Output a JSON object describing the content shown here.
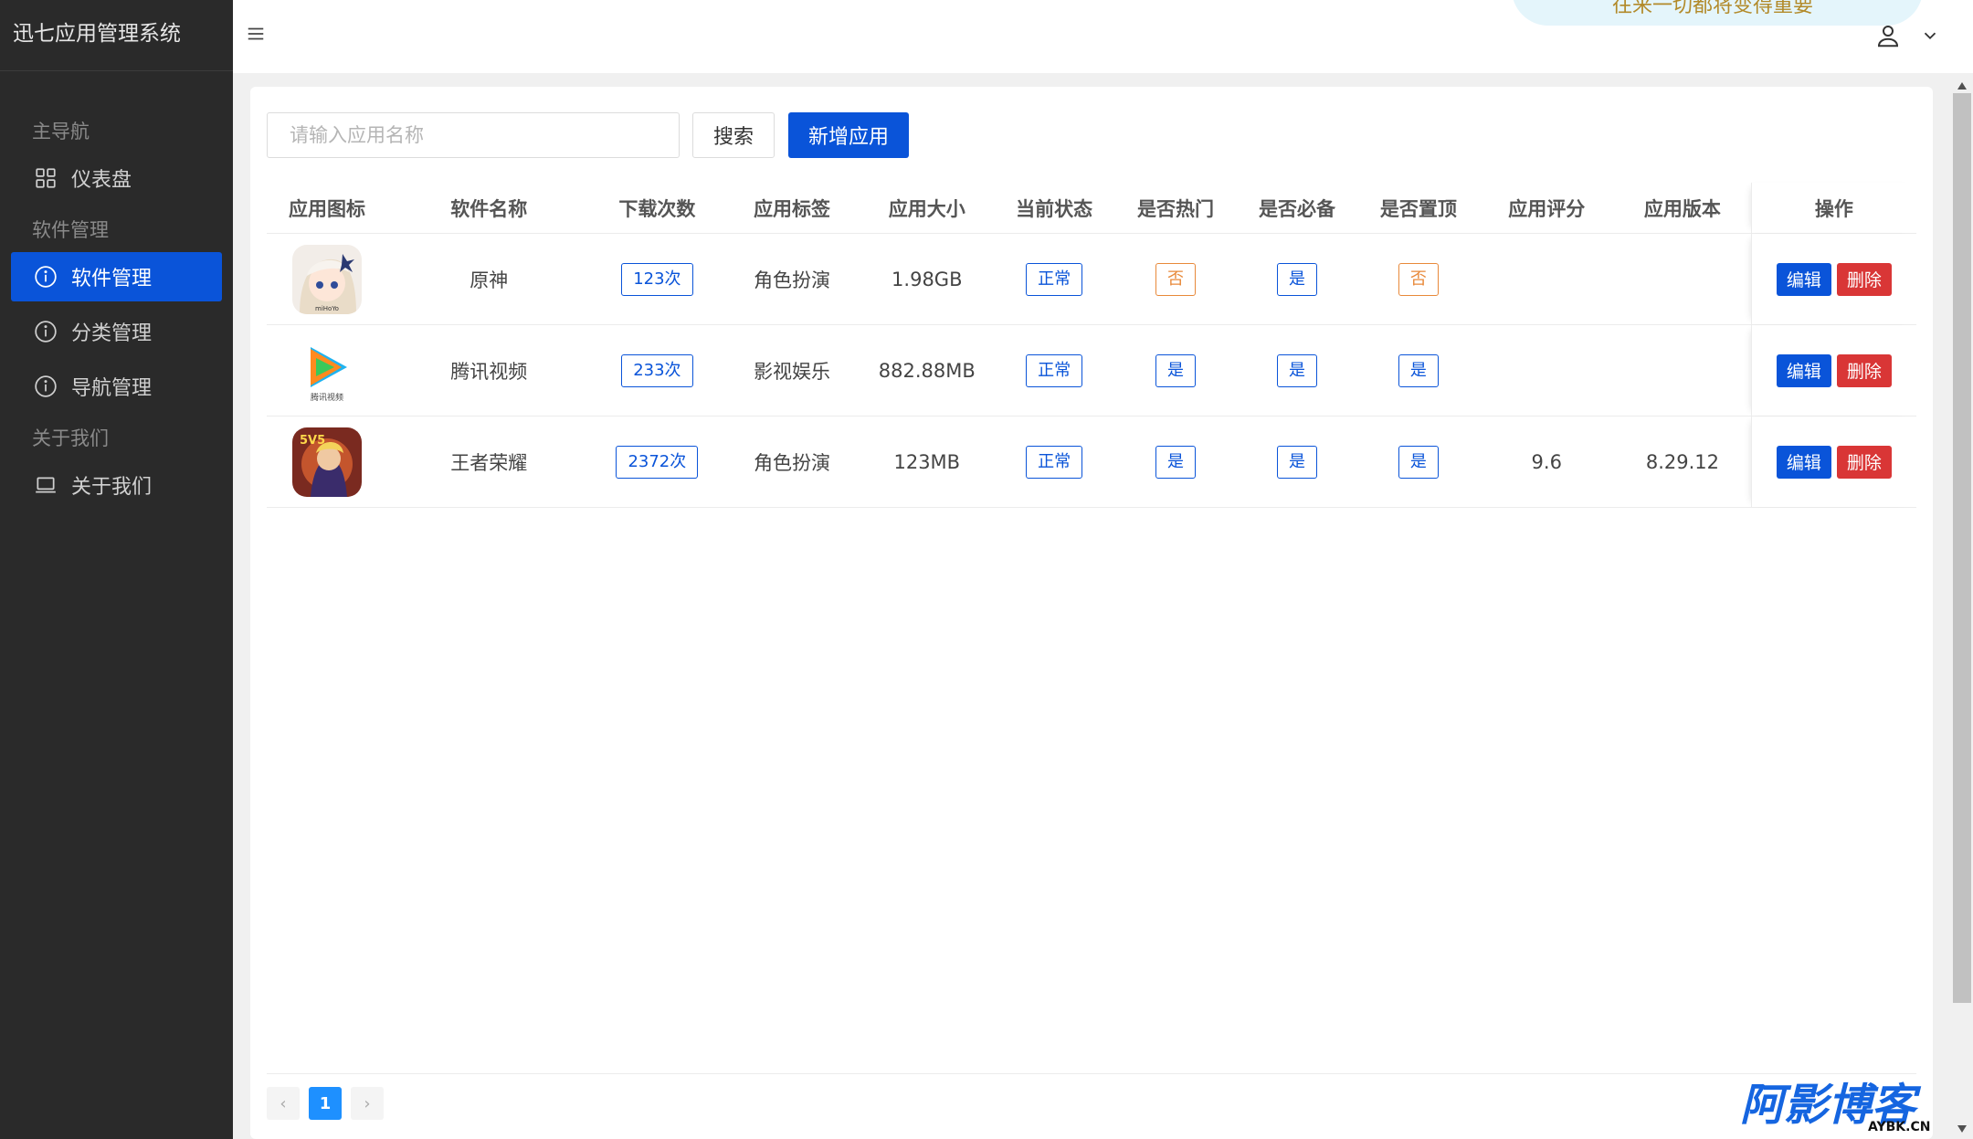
{
  "app": {
    "title": "迅七应用管理系统"
  },
  "sidebar": {
    "groups": [
      {
        "label": "主导航"
      },
      {
        "label": "软件管理"
      },
      {
        "label": "关于我们"
      }
    ],
    "items": [
      {
        "label": "仪表盘",
        "icon": "grid-icon"
      },
      {
        "label": "软件管理",
        "icon": "info-circle-icon",
        "active": true
      },
      {
        "label": "分类管理",
        "icon": "info-circle-icon"
      },
      {
        "label": "导航管理",
        "icon": "info-circle-icon"
      },
      {
        "label": "关于我们",
        "icon": "laptop-icon"
      }
    ]
  },
  "header": {
    "banner_text": "往来一切都将变得重要"
  },
  "toolbar": {
    "search_placeholder": "请输入应用名称",
    "search_label": "搜索",
    "add_label": "新增应用"
  },
  "table": {
    "columns": [
      "应用图标",
      "软件名称",
      "下载次数",
      "应用标签",
      "应用大小",
      "当前状态",
      "是否热门",
      "是否必备",
      "是否置顶",
      "应用评分",
      "应用版本",
      "操作"
    ],
    "rows": [
      {
        "name": "原神",
        "downloads": "123次",
        "tag": "角色扮演",
        "size": "1.98GB",
        "state": "正常",
        "hot": "否",
        "must": "是",
        "top": "否",
        "rating": "",
        "version": ""
      },
      {
        "name": "腾讯视频",
        "downloads": "233次",
        "tag": "影视娱乐",
        "size": "882.88MB",
        "state": "正常",
        "hot": "是",
        "must": "是",
        "top": "是",
        "rating": "",
        "version": ""
      },
      {
        "name": "王者荣耀",
        "downloads": "2372次",
        "tag": "角色扮演",
        "size": "123MB",
        "state": "正常",
        "hot": "是",
        "must": "是",
        "top": "是",
        "rating": "9.6",
        "version": "8.29.12"
      }
    ],
    "edit_label": "编辑",
    "delete_label": "删除"
  },
  "pagination": {
    "current": "1",
    "prev": "‹",
    "next": "›"
  },
  "icon_text": {
    "genshin": "miHoYo",
    "tencent": "腾讯视频",
    "honor": "5V5"
  },
  "watermark": {
    "text": "阿影博客",
    "sub": "AYBK.CN"
  },
  "colors": {
    "primary": "#0a54d9",
    "danger": "#d93636",
    "warning": "#e8893a",
    "sidebar": "#2a2a2a"
  }
}
